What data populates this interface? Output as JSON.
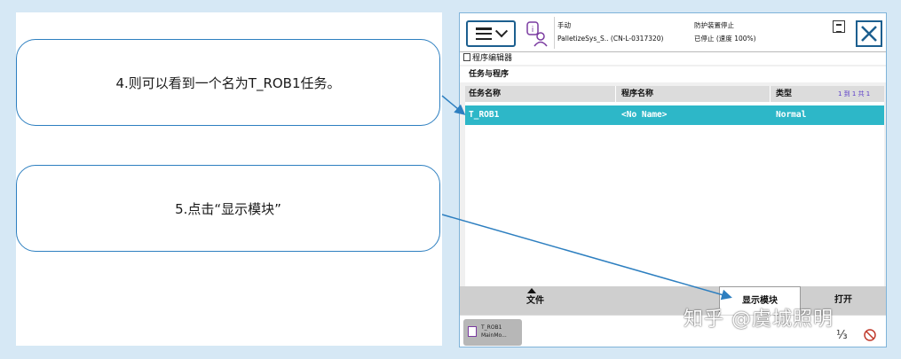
{
  "callouts": {
    "step4": "4.则可以看到一个名为T_ROB1任务。",
    "step5": "5.点击“显示模块”"
  },
  "pendant": {
    "status": {
      "mode": "手动",
      "station": "PalletizeSys_S.. (CN-L-0317320)",
      "safety": "防护装置停止",
      "state": "已停止 (速度 100%)"
    },
    "window_title": "程序编辑器",
    "section_title": "任务与程序",
    "table": {
      "headers": {
        "task": "任务名称",
        "program": "程序名称",
        "type": "类型"
      },
      "count": "1 到 1 共 1",
      "rows": [
        {
          "task": "T_ROB1",
          "program": "<No Name>",
          "type": "Normal"
        }
      ]
    },
    "buttons": {
      "file": "文件",
      "show_module": "显示模块",
      "open": "打开"
    },
    "taskbar": {
      "chip_line1": "T_ROB1",
      "chip_line2": "MainMo..."
    },
    "icons": {
      "menu": "hamburger-icon",
      "close": "close-icon",
      "robot": "robot-status-icon",
      "log": "event-log-icon",
      "quickset": "quickset-icon"
    }
  },
  "watermark": "知乎 @虞城照明",
  "colors": {
    "selected_row": "#2db7c8",
    "callout_border": "#2d7fc0",
    "arrow": "#2d7fc0"
  }
}
